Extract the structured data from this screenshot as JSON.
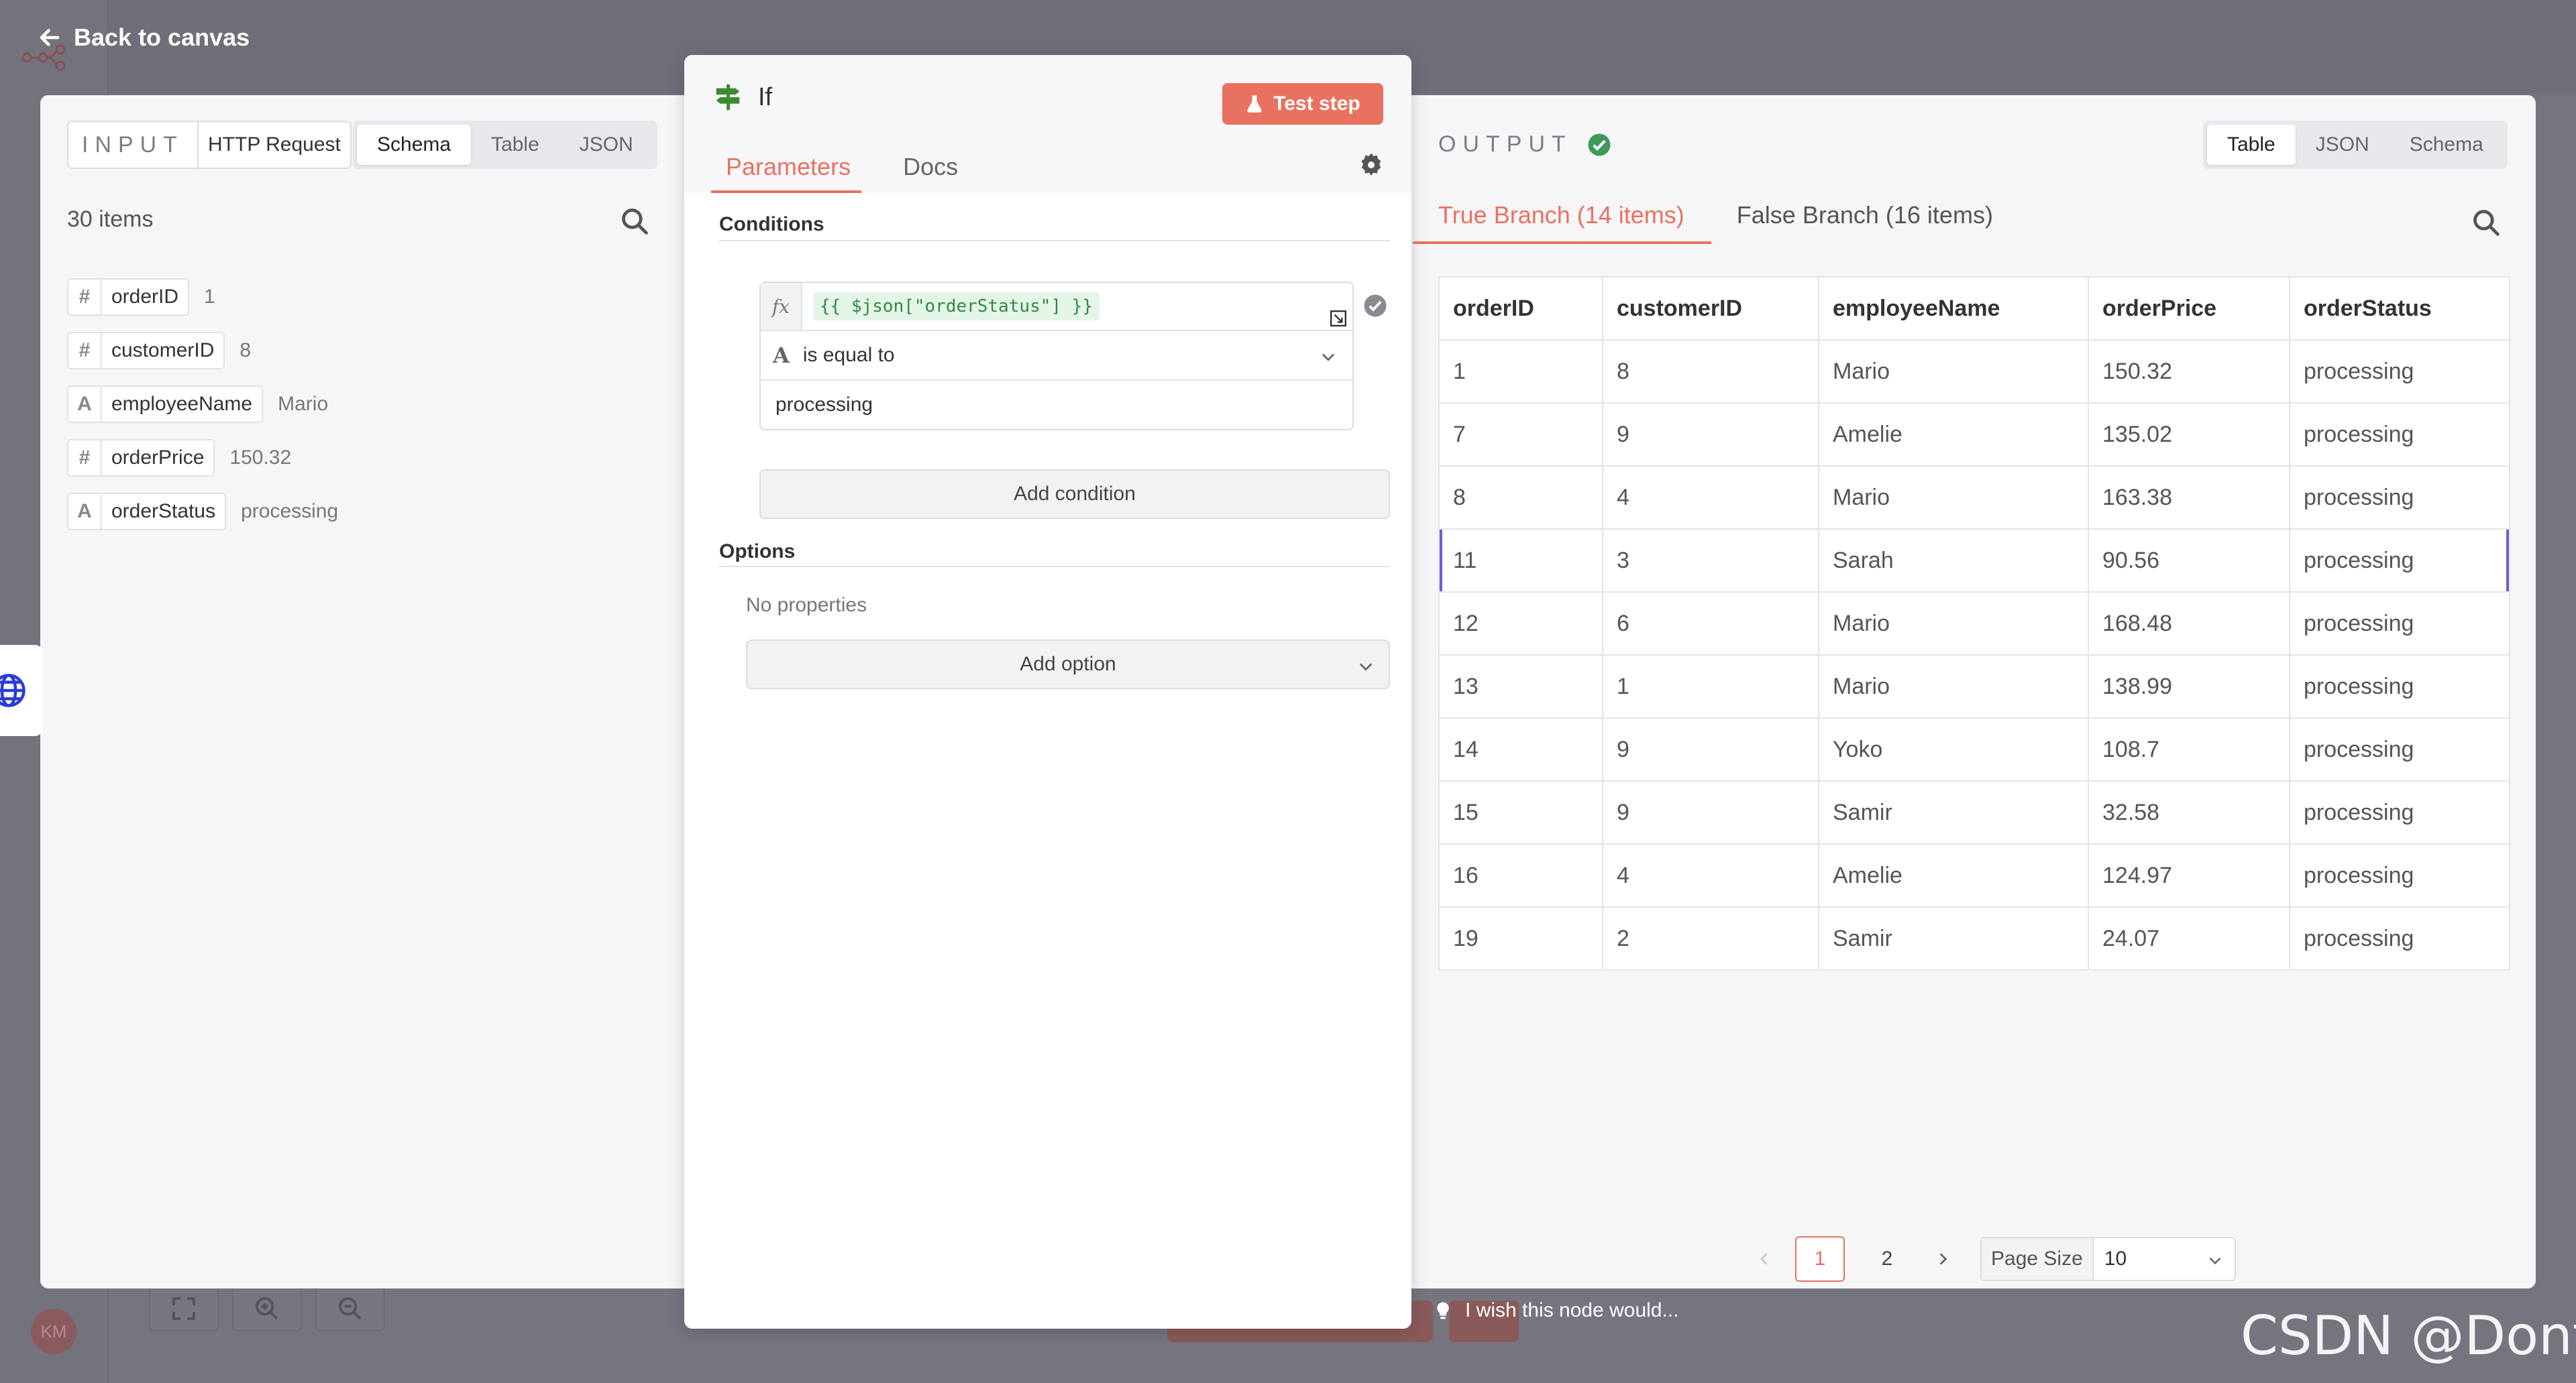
{
  "canvas": {
    "back_label": "Back to canvas",
    "avatar_initials": "KM",
    "wish_text": "I wish this node would..."
  },
  "input": {
    "label": "INPUT",
    "node_name": "HTTP Request",
    "view_tabs": [
      {
        "label": "Schema",
        "active": true
      },
      {
        "label": "Table",
        "active": false
      },
      {
        "label": "JSON",
        "active": false
      }
    ],
    "items_count": "30 items",
    "schema": [
      {
        "type_icon": "#",
        "name": "orderID",
        "value": "1"
      },
      {
        "type_icon": "#",
        "name": "customerID",
        "value": "8"
      },
      {
        "type_icon": "A",
        "name": "employeeName",
        "value": "Mario"
      },
      {
        "type_icon": "#",
        "name": "orderPrice",
        "value": "150.32"
      },
      {
        "type_icon": "A",
        "name": "orderStatus",
        "value": "processing"
      }
    ]
  },
  "parameters": {
    "node_title": "If",
    "test_step_label": "Test step",
    "tabs": [
      {
        "label": "Parameters",
        "active": true
      },
      {
        "label": "Docs",
        "active": false
      }
    ],
    "conditions_label": "Conditions",
    "condition": {
      "fx_label": "fx",
      "expression": "{{ $json[\"orderStatus\"] }}",
      "type_icon": "A",
      "operator": "is equal to",
      "value": "processing"
    },
    "add_condition_label": "Add condition",
    "options_label": "Options",
    "no_properties_label": "No properties",
    "add_option_label": "Add option"
  },
  "output": {
    "label": "OUTPUT",
    "status_color": "#3f9a57",
    "view_tabs": [
      {
        "label": "Table",
        "active": true
      },
      {
        "label": "JSON",
        "active": false
      },
      {
        "label": "Schema",
        "active": false
      }
    ],
    "branches": [
      {
        "label": "True Branch (14 items)",
        "active": true
      },
      {
        "label": "False Branch (16 items)",
        "active": false
      }
    ],
    "columns": [
      "orderID",
      "customerID",
      "employeeName",
      "orderPrice",
      "orderStatus"
    ],
    "rows": [
      [
        "1",
        "8",
        "Mario",
        "150.32",
        "processing"
      ],
      [
        "7",
        "9",
        "Amelie",
        "135.02",
        "processing"
      ],
      [
        "8",
        "4",
        "Mario",
        "163.38",
        "processing"
      ],
      [
        "11",
        "3",
        "Sarah",
        "90.56",
        "processing"
      ],
      [
        "12",
        "6",
        "Mario",
        "168.48",
        "processing"
      ],
      [
        "13",
        "1",
        "Mario",
        "138.99",
        "processing"
      ],
      [
        "14",
        "9",
        "Yoko",
        "108.7",
        "processing"
      ],
      [
        "15",
        "9",
        "Samir",
        "32.58",
        "processing"
      ],
      [
        "16",
        "4",
        "Amelie",
        "124.97",
        "processing"
      ],
      [
        "19",
        "2",
        "Samir",
        "24.07",
        "processing"
      ]
    ],
    "highlighted_row": 3,
    "pages": [
      "1",
      "2"
    ],
    "current_page": "1",
    "page_size_label": "Page Size",
    "page_size_value": "10"
  },
  "watermark": "CSDN @Dontla",
  "colors": {
    "accent": "#e8725f",
    "success": "#3f9a57",
    "highlight_row": "#6b5fd1"
  }
}
